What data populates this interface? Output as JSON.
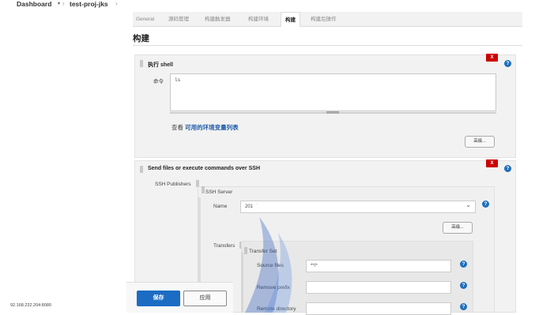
{
  "breadcrumb": {
    "dashboard": "Dashboard",
    "project": "test-proj-jks"
  },
  "tabs": [
    "General",
    "源码管理",
    "构建触发器",
    "构建环境",
    "构建",
    "构建后操作"
  ],
  "active_tab": "构建",
  "section_title": "构建",
  "shell_step": {
    "title": "执行 shell",
    "delete_label": "X",
    "command_label": "命令",
    "command_value": "ls",
    "env_prefix": "查看",
    "env_link": "可用的环境变量列表",
    "advanced_label": "高级..."
  },
  "ssh_step": {
    "title": "Send files or execute commands over SSH",
    "delete_label": "X",
    "publishers_label": "SSH Publishers",
    "server_label": "SSH Server",
    "name_label": "Name",
    "name_value": "201",
    "advanced_label": "高级...",
    "transfers_label": "Transfers",
    "transfer_set_label": "Transfer Set",
    "source_files_label": "Source files",
    "source_files_value": "**/*",
    "remove_prefix_label": "Remove prefix",
    "remove_prefix_value": "",
    "remote_dir_label": "Remote directory",
    "remote_dir_value": ""
  },
  "buttons": {
    "save": "保存",
    "apply": "应用"
  },
  "status_url": "92.168.232.204:8080",
  "icons": {
    "help": "?",
    "caret": "▾",
    "chevron": "›",
    "select_arrow": "⌄"
  },
  "colors": {
    "accent": "#1c6cc4",
    "delete": "#cc0000",
    "link": "#1e5ba8"
  }
}
